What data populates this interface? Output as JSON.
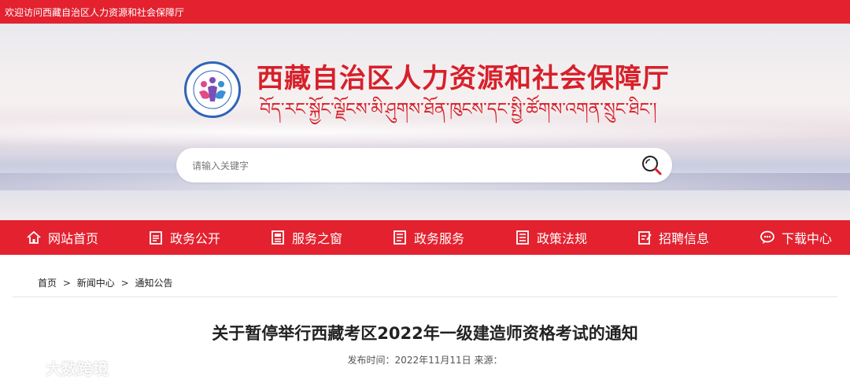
{
  "topbar": {
    "welcome": "欢迎访问西藏自治区人力资源和社会保障厅"
  },
  "header": {
    "title_zh": "西藏自治区人力资源和社会保障厅",
    "title_bo": "བོད་རང་སྐྱོང་ལྗོངས་མི་ཤུགས་ཐོན་ཁུངས་དང་སྤྱི་ཚོགས་འགན་སྲུང་ཐིང་།"
  },
  "search": {
    "placeholder": "请输入关键字"
  },
  "nav": {
    "items": [
      {
        "label": "网站首页",
        "icon": "home-icon"
      },
      {
        "label": "政务公开",
        "icon": "clipboard-icon"
      },
      {
        "label": "服务之窗",
        "icon": "document-icon"
      },
      {
        "label": "政务服务",
        "icon": "list-icon"
      },
      {
        "label": "政策法规",
        "icon": "policy-icon"
      },
      {
        "label": "招聘信息",
        "icon": "edit-icon"
      },
      {
        "label": "下载中心",
        "icon": "chat-icon"
      }
    ]
  },
  "breadcrumb": {
    "items": [
      "首页",
      "新闻中心",
      "通知公告"
    ],
    "separator": ">"
  },
  "article": {
    "title": "关于暂停举行西藏考区2022年一级建造师资格考试的通知",
    "meta": "发布时间：2022年11月11日 来源："
  },
  "watermark": {
    "text": "大数跨境"
  },
  "colors": {
    "brand_red": "#e3212f",
    "title_red": "#d7202a",
    "logo_blue": "#2f64b8"
  }
}
